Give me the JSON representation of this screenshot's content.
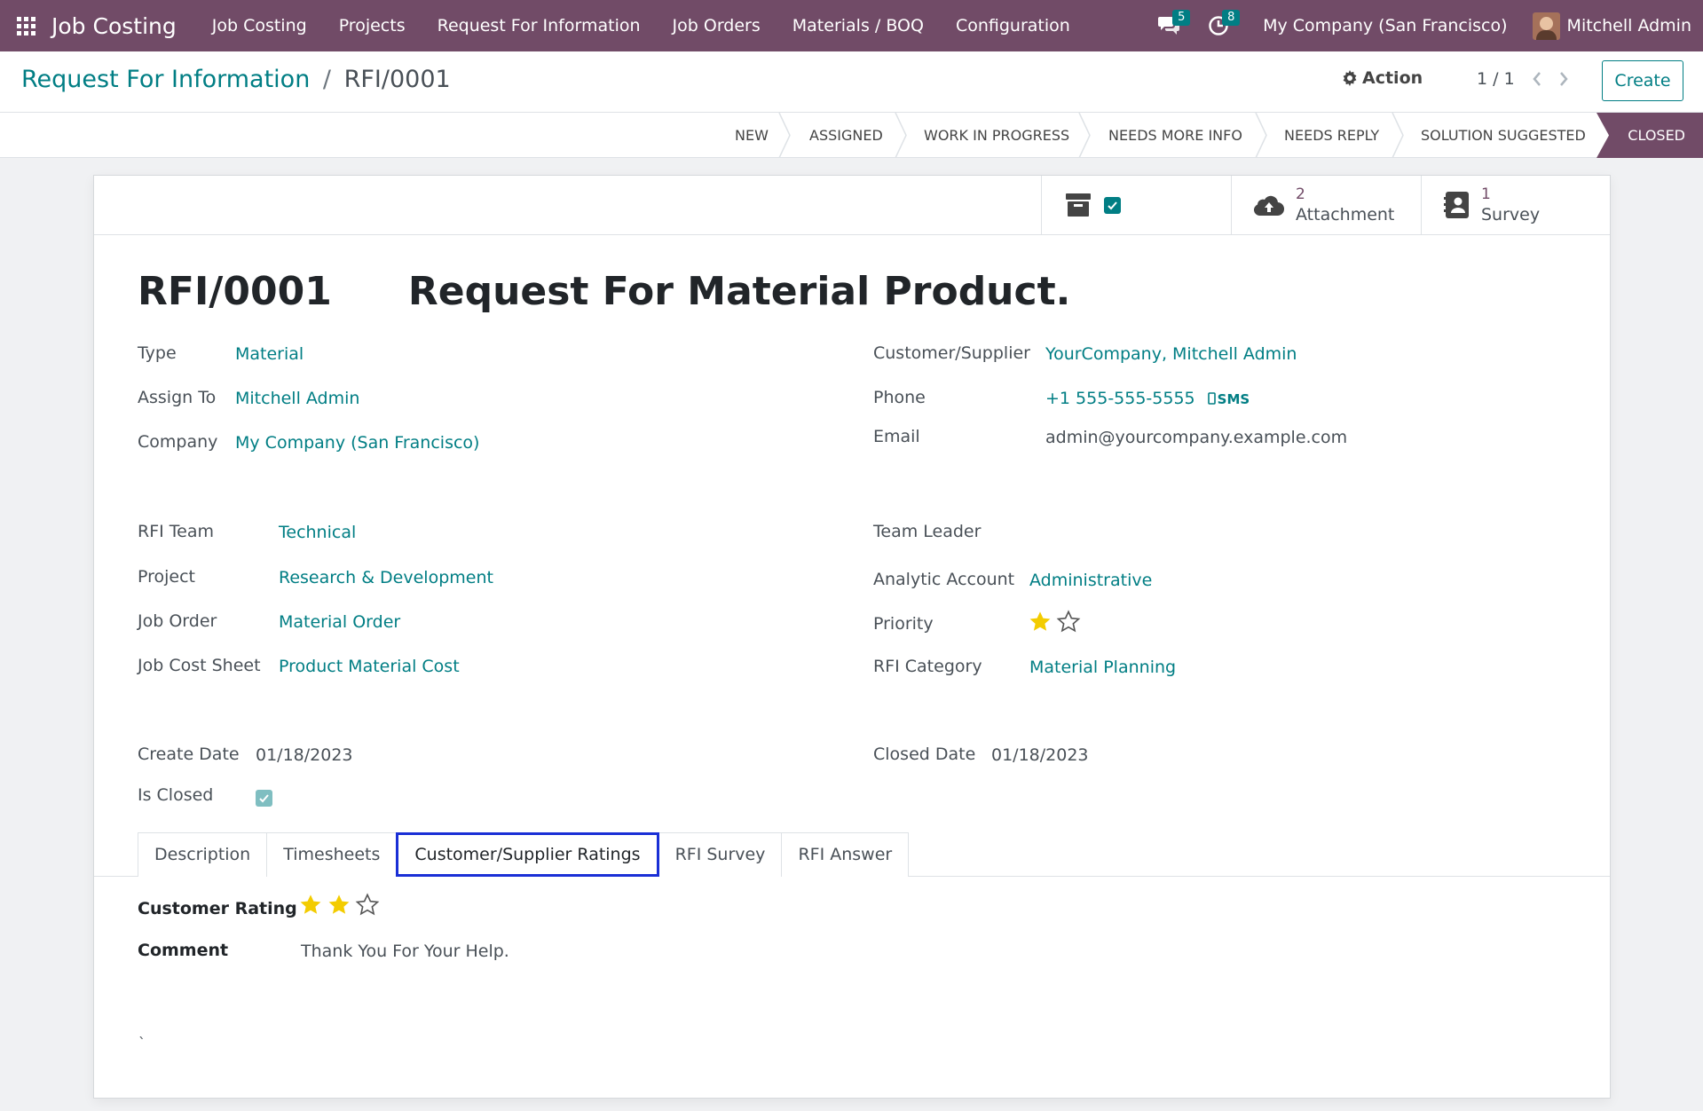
{
  "navbar": {
    "app_title": "Job Costing",
    "menu": [
      "Job Costing",
      "Projects",
      "Request For Information",
      "Job Orders",
      "Materials / BOQ",
      "Configuration"
    ],
    "messages_count": "5",
    "activities_count": "8",
    "company": "My Company (San Francisco)",
    "user": "Mitchell Admin"
  },
  "control": {
    "breadcrumb_parent": "Request For Information",
    "breadcrumb_sep": "/",
    "breadcrumb_current": "RFI/0001",
    "action_label": "Action",
    "pager": "1 / 1",
    "create_label": "Create"
  },
  "stages": [
    "NEW",
    "ASSIGNED",
    "WORK IN PROGRESS",
    "NEEDS MORE INFO",
    "NEEDS REPLY",
    "SOLUTION SUGGESTED",
    "CLOSED"
  ],
  "buttons": {
    "attachment_count": "2",
    "attachment_label": "Attachment",
    "survey_count": "1",
    "survey_label": "Survey"
  },
  "record": {
    "code": "RFI/0001",
    "name": "Request For Material Product."
  },
  "fields": {
    "type_label": "Type",
    "type": "Material",
    "assign_label": "Assign To",
    "assign": "Mitchell Admin",
    "company_label": "Company",
    "company": "My Company (San Francisco)",
    "customer_label": "Customer/Supplier",
    "customer": "YourCompany, Mitchell Admin",
    "phone_label": "Phone",
    "phone": "+1 555-555-5555",
    "sms": "SMS",
    "email_label": "Email",
    "email": "admin@yourcompany.example.com",
    "team_label": "RFI Team",
    "team": "Technical",
    "project_label": "Project",
    "project": "Research & Development",
    "job_order_label": "Job Order",
    "job_order": "Material Order",
    "cost_sheet_label": "Job Cost Sheet",
    "cost_sheet": "Product Material Cost",
    "team_leader_label": "Team Leader",
    "analytic_label": "Analytic Account",
    "analytic": "Administrative",
    "priority_label": "Priority",
    "priority_value": 1,
    "priority_max": 2,
    "category_label": "RFI Category",
    "category": "Material Planning",
    "create_date_label": "Create Date",
    "create_date": "01/18/2023",
    "closed_date_label": "Closed Date",
    "closed_date": "01/18/2023",
    "is_closed_label": "Is Closed",
    "is_closed": true
  },
  "tabs": [
    "Description",
    "Timesheets",
    "Customer/Supplier Ratings",
    "RFI Survey",
    "RFI Answer"
  ],
  "active_tab": 2,
  "ratings": {
    "rating_label": "Customer Rating",
    "rating_value": 2,
    "rating_max": 3,
    "comment_label": "Comment",
    "comment": "Thank You For Your Help.",
    "stray_char": "`"
  },
  "colors": {
    "brand": "#714b67",
    "accent": "#017e84",
    "star": "#f3cc00"
  },
  "icons": [
    "apps-grid-icon",
    "chat-icon",
    "clock-icon",
    "gear-icon",
    "chevron-left-icon",
    "chevron-right-icon",
    "archive-icon",
    "cloud-upload-icon",
    "survey-icon",
    "mobile-icon",
    "star-icon"
  ]
}
